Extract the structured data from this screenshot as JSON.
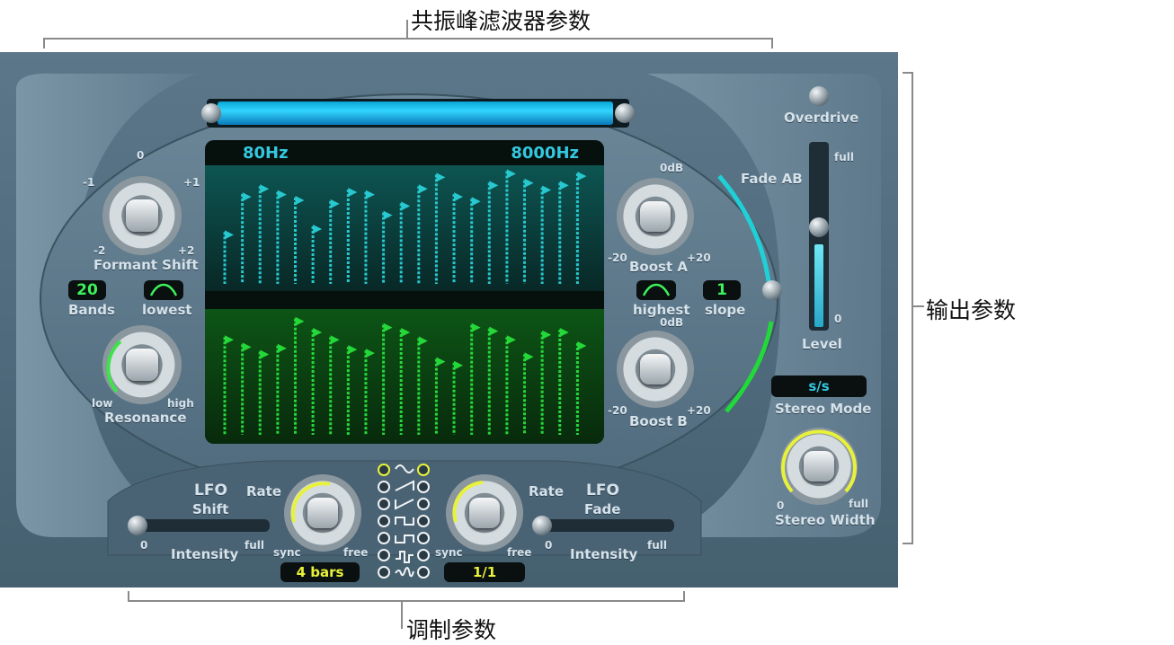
{
  "annotations": {
    "formant": "共振峰滤波器参数",
    "output": "输出参数",
    "modulation": "调制参数"
  },
  "plugin": {
    "freq_low": "80Hz",
    "freq_high": "8000Hz",
    "formant_shift": {
      "label": "Formant Shift",
      "tick_top": "0",
      "tick_left": "-1",
      "tick_right": "+1",
      "tick_bl": "-2",
      "tick_br": "+2"
    },
    "bands": {
      "value": "20",
      "label": "Bands"
    },
    "lowest": {
      "label": "lowest"
    },
    "resonance": {
      "label": "Resonance",
      "low": "low",
      "high": "high"
    },
    "boost_a": {
      "label": "Boost A",
      "top": "0dB",
      "min": "-20",
      "max": "+20"
    },
    "boost_b": {
      "label": "Boost B",
      "top": "0dB",
      "min": "-20",
      "max": "+20"
    },
    "highest": {
      "label": "highest"
    },
    "slope": {
      "value": "1",
      "label": "slope"
    },
    "fade_ab": "Fade AB",
    "overdrive": "Overdrive",
    "level": {
      "label": "Level",
      "full": "full",
      "zero": "0"
    },
    "stereo_mode": {
      "value": "s/s",
      "label": "Stereo Mode"
    },
    "stereo_width": {
      "label": "Stereo Width",
      "min": "0",
      "max": "full"
    },
    "lfo_shift": {
      "title": "LFO",
      "sub": "Shift",
      "rate": "Rate",
      "sync": "sync",
      "free": "free",
      "value": "4 bars",
      "intensity": "Intensity",
      "min": "0",
      "max": "full"
    },
    "lfo_fade": {
      "title": "LFO",
      "sub": "Fade",
      "rate": "Rate",
      "sync": "sync",
      "free": "free",
      "value": "1/1",
      "intensity": "Intensity",
      "min": "0",
      "max": "full"
    },
    "waveforms": [
      "sine-wave-icon",
      "saw-up-icon",
      "saw-down-icon",
      "square-up-icon",
      "square-down-icon",
      "random-step-icon",
      "random-smooth-icon"
    ],
    "bands_a_levels": [
      0.45,
      0.78,
      0.85,
      0.8,
      0.75,
      0.5,
      0.72,
      0.82,
      0.8,
      0.62,
      0.7,
      0.85,
      0.95,
      0.78,
      0.74,
      0.88,
      0.98,
      0.9,
      0.84,
      0.88,
      0.96
    ],
    "bands_b_levels": [
      0.8,
      0.74,
      0.68,
      0.73,
      0.95,
      0.86,
      0.8,
      0.72,
      0.69,
      0.9,
      0.86,
      0.79,
      0.62,
      0.59,
      0.9,
      0.87,
      0.8,
      0.66,
      0.84,
      0.86,
      0.75
    ],
    "colors": {
      "filter_a": "#27c8cf",
      "filter_b": "#25d83a",
      "lcd": "#3df25a",
      "accent_yellow": "#e8f23a"
    }
  }
}
